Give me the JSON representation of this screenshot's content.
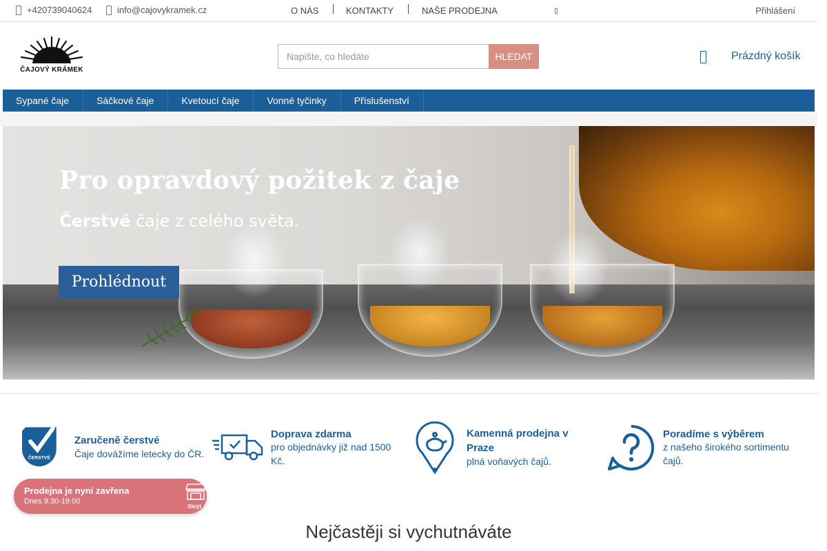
{
  "topbar": {
    "phone": "+420739040624",
    "email": "info@cajovykramek.cz",
    "nav": [
      "O NÁS",
      "KONTAKTY",
      "NAŠE PRODEJNA"
    ],
    "login": "Přihlášení"
  },
  "header": {
    "logo_text": "ČAJOVÝ KRÁMEK",
    "search_placeholder": "Napište, co hledáte",
    "search_button": "HLEDAT",
    "cart_label": "Prázdný košík"
  },
  "categories": [
    "Sypané čaje",
    "Sáčkové čaje",
    "Kvetoucí čaje",
    "Vonné tyčinky",
    "Příslušenství"
  ],
  "banner": {
    "title": "Pro opravdový požitek z čaje",
    "subtitle_bold": "Čerstvé",
    "subtitle_rest": " čaje z celého světa.",
    "button": "Prohlédnout"
  },
  "usps": [
    {
      "title": "Zaručeně čerstvé",
      "subtitle": "Čaje dovážíme letecky do ČR.",
      "icon": "fresh-badge-icon",
      "badge": "ČERSTVÉ"
    },
    {
      "title": "Doprava zdarma",
      "subtitle": "pro objednávky již nad 1500 Kč.",
      "icon": "delivery-truck-icon"
    },
    {
      "title": "Kamenná prodejna v Praze",
      "subtitle": "plná voňavých čajů.",
      "icon": "teapot-location-icon"
    },
    {
      "title": "Poradíme s výběrem",
      "subtitle": "z našeho širokého sortimentu čajů.",
      "icon": "question-bubble-icon"
    }
  ],
  "store_widget": {
    "status": "Prodejna je nyní zavřena",
    "hours": "Dnes 9:30-19:00",
    "hide_label": "Skrýt"
  },
  "section_title": "Nejčastěji si vychutnáváte",
  "colors": {
    "brand_blue": "#1a5f9a",
    "search_button": "#d98e84",
    "store_widget": "#d9737a"
  }
}
